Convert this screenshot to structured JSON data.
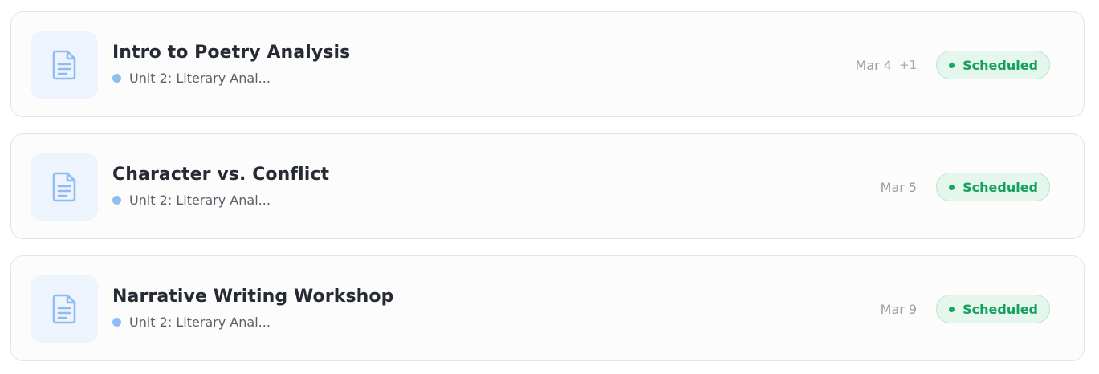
{
  "colors": {
    "title": "#262a33",
    "unit_dot": "#8fbcf1",
    "icon_tile_bg": "#edf4fd",
    "icon_stroke": "#8fbcf1",
    "status_scheduled_text": "#16a05e",
    "status_scheduled_bg": "#e5f6ed"
  },
  "lessons": [
    {
      "icon": "document-icon",
      "title": "Intro to Poetry Analysis",
      "unit": "Unit 2: Literary Anal...",
      "date": "Mar 4",
      "extra": "+1",
      "status": "Scheduled"
    },
    {
      "icon": "document-icon",
      "title": "Character vs. Conflict",
      "unit": "Unit 2: Literary Anal...",
      "date": "Mar 5",
      "extra": "",
      "status": "Scheduled"
    },
    {
      "icon": "document-icon",
      "title": "Narrative Writing Workshop",
      "unit": "Unit 2: Literary Anal...",
      "date": "Mar 9",
      "extra": "",
      "status": "Scheduled"
    }
  ]
}
